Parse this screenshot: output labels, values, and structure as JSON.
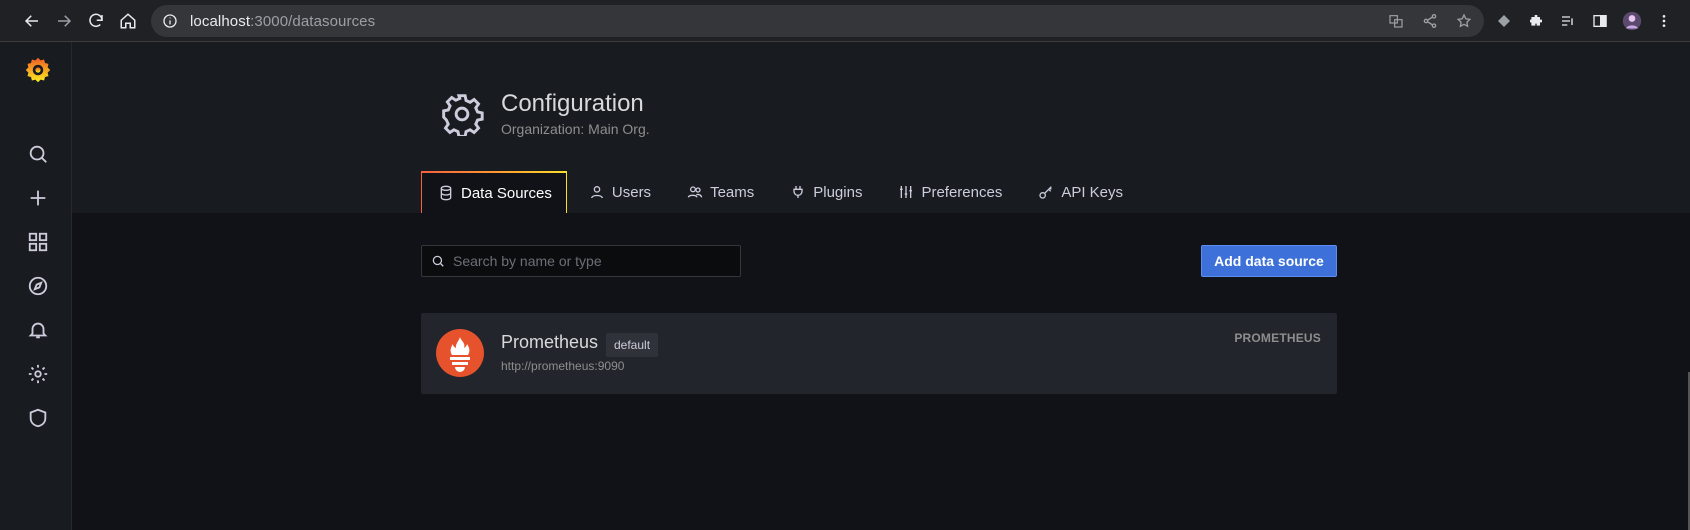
{
  "browser": {
    "url_host": "localhost",
    "url_path": ":3000/datasources"
  },
  "header": {
    "title": "Configuration",
    "subtitle": "Organization: Main Org."
  },
  "tabs": [
    {
      "label": "Data Sources",
      "icon": "database-icon",
      "active": true
    },
    {
      "label": "Users",
      "icon": "user-icon",
      "active": false
    },
    {
      "label": "Teams",
      "icon": "users-icon",
      "active": false
    },
    {
      "label": "Plugins",
      "icon": "plug-icon",
      "active": false
    },
    {
      "label": "Preferences",
      "icon": "sliders-icon",
      "active": false
    },
    {
      "label": "API Keys",
      "icon": "key-icon",
      "active": false
    }
  ],
  "search": {
    "placeholder": "Search by name or type",
    "value": ""
  },
  "add_button_label": "Add data source",
  "datasources": [
    {
      "name": "Prometheus",
      "badge": "default",
      "url": "http://prometheus:9090",
      "type": "PROMETHEUS"
    }
  ],
  "colors": {
    "accent": "#3d71d9",
    "prometheus": "#e6522c",
    "background": "#111217",
    "panel": "#181b1f"
  }
}
